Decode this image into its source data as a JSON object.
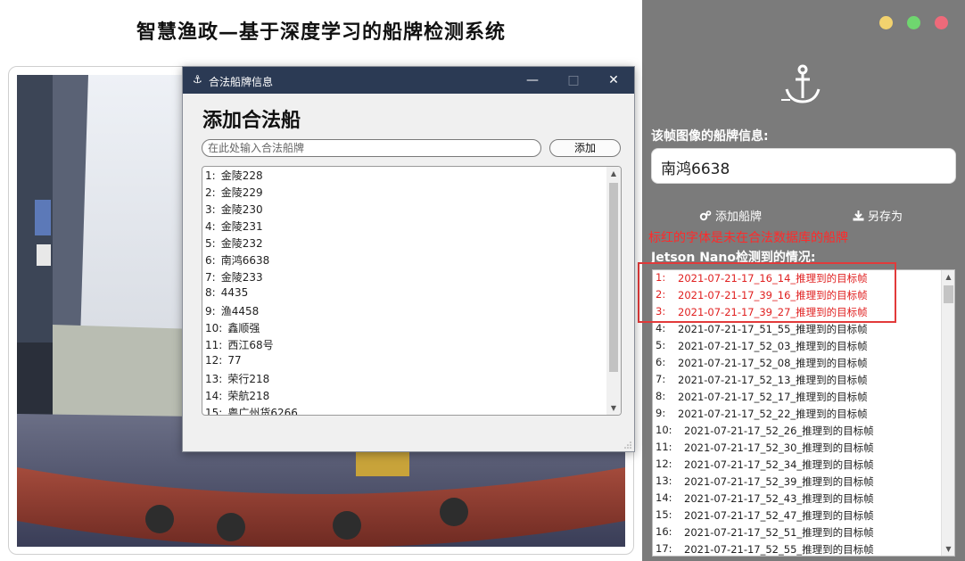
{
  "app": {
    "title": "智慧渔政—基于深度学习的船牌检测系统"
  },
  "dialog": {
    "window_title": "合法船牌信息",
    "title_icon": "anchor-icon",
    "minimize": "—",
    "maximize": "□",
    "close": "✕",
    "heading": "添加合法船",
    "input_placeholder": "在此处输入合法船牌",
    "input_value": "",
    "add_button": "添加",
    "list": [
      {
        "num": "1:",
        "name": "金陵228"
      },
      {
        "num": "2:",
        "name": "金陵229"
      },
      {
        "num": "3:",
        "name": "金陵230"
      },
      {
        "num": "4:",
        "name": "金陵231"
      },
      {
        "num": "5:",
        "name": "金陵232"
      },
      {
        "num": "6:",
        "name": "南鸿6638"
      },
      {
        "num": "7:",
        "name": "金陵233"
      },
      {
        "num": "8:",
        "name": "4435"
      },
      {
        "num": "9:",
        "name": "渔4458"
      },
      {
        "num": "10:",
        "name": "鑫顺强"
      },
      {
        "num": "11:",
        "name": "西江68号"
      },
      {
        "num": "12:",
        "name": "77"
      },
      {
        "num": "13:",
        "name": "荣行218"
      },
      {
        "num": "14:",
        "name": "荣航218"
      },
      {
        "num": "15:",
        "name": "粤广州货6266"
      }
    ]
  },
  "panel": {
    "window_dots": [
      "#f2d26e",
      "#6fd66f",
      "#ee6a7a"
    ],
    "logo_icon": "anchor-icon",
    "frame_info_label": "该帧图像的船牌信息:",
    "frame_plate": "南鸿6638",
    "add_plate_button": "添加船牌",
    "save_as_button": "另存为",
    "warning": "标红的字体是未在合法数据库的船牌",
    "jetson_label": "Jetson Nano检测到的情况:",
    "highlight_color": "#e23a3a",
    "detections": [
      {
        "num": "1:",
        "text": "2021-07-21-17_16_14_推理到的目标帧",
        "red": true
      },
      {
        "num": "2:",
        "text": "2021-07-21-17_39_16_推理到的目标帧",
        "red": true
      },
      {
        "num": "3:",
        "text": "2021-07-21-17_39_27_推理到的目标帧",
        "red": true
      },
      {
        "num": "4:",
        "text": "2021-07-21-17_51_55_推理到的目标帧",
        "red": false
      },
      {
        "num": "5:",
        "text": "2021-07-21-17_52_03_推理到的目标帧",
        "red": false
      },
      {
        "num": "6:",
        "text": "2021-07-21-17_52_08_推理到的目标帧",
        "red": false
      },
      {
        "num": "7:",
        "text": "2021-07-21-17_52_13_推理到的目标帧",
        "red": false
      },
      {
        "num": "8:",
        "text": "2021-07-21-17_52_17_推理到的目标帧",
        "red": false
      },
      {
        "num": "9:",
        "text": "2021-07-21-17_52_22_推理到的目标帧",
        "red": false
      },
      {
        "num": "10:",
        "text": "2021-07-21-17_52_26_推理到的目标帧",
        "red": false
      },
      {
        "num": "11:",
        "text": "2021-07-21-17_52_30_推理到的目标帧",
        "red": false
      },
      {
        "num": "12:",
        "text": "2021-07-21-17_52_34_推理到的目标帧",
        "red": false
      },
      {
        "num": "13:",
        "text": "2021-07-21-17_52_39_推理到的目标帧",
        "red": false
      },
      {
        "num": "14:",
        "text": "2021-07-21-17_52_43_推理到的目标帧",
        "red": false
      },
      {
        "num": "15:",
        "text": "2021-07-21-17_52_47_推理到的目标帧",
        "red": false
      },
      {
        "num": "16:",
        "text": "2021-07-21-17_52_51_推理到的目标帧",
        "red": false
      },
      {
        "num": "17:",
        "text": "2021-07-21-17_52_55_推理到的目标帧",
        "red": false
      }
    ]
  }
}
